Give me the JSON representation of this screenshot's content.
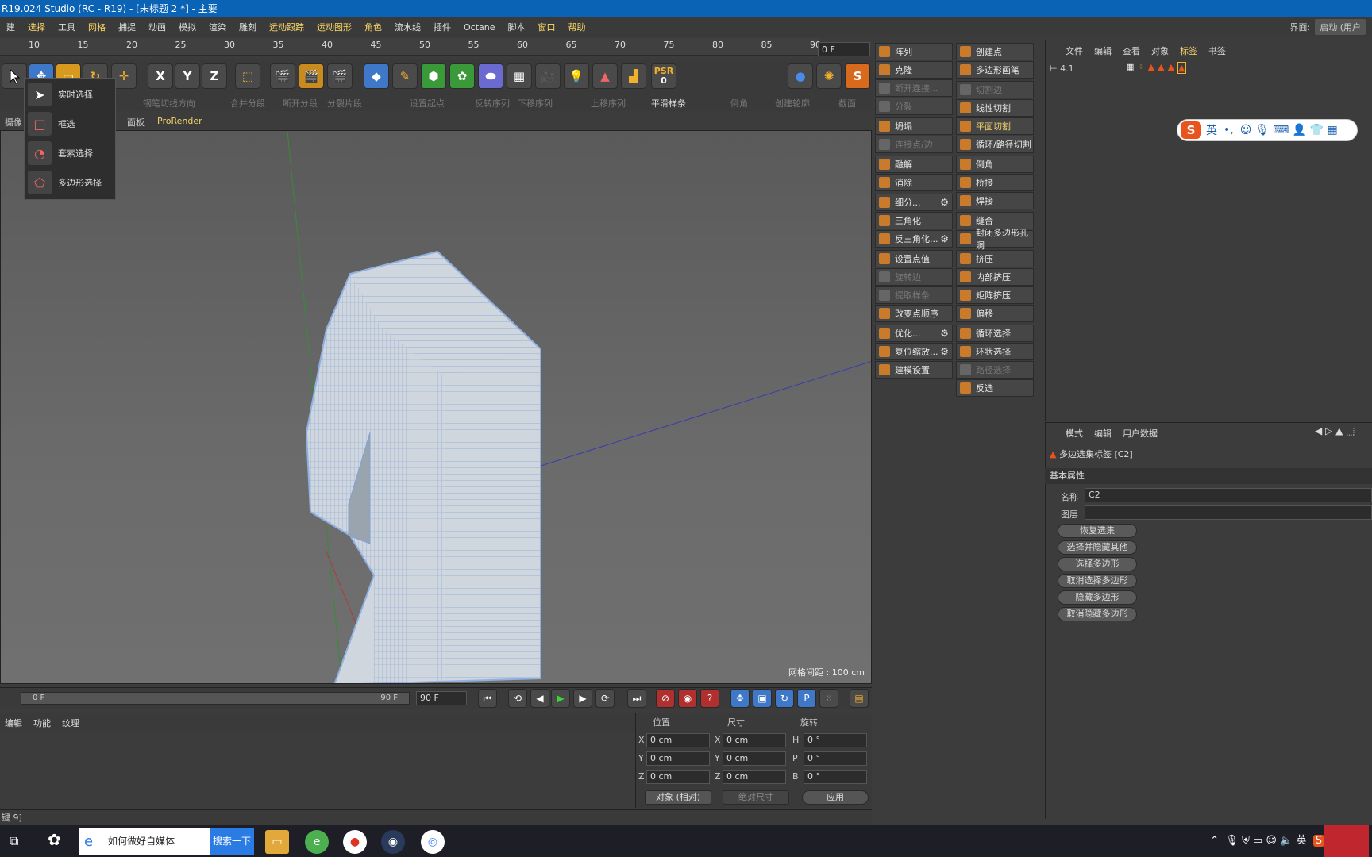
{
  "window": {
    "title": "R19.024 Studio (RC - R19) - [未标题 2 *] - 主要",
    "layout_label": "界面:",
    "layout_value": "启动 (用户"
  },
  "menu": [
    "建",
    "选择",
    "工具",
    "网格",
    "捕捉",
    "动画",
    "模拟",
    "渲染",
    "雕刻",
    "运动跟踪",
    "运动图形",
    "角色",
    "流水线",
    "插件",
    "Octane",
    "脚本",
    "窗口",
    "帮助"
  ],
  "ruler": {
    "ticks": [
      "10",
      "15",
      "20",
      "25",
      "30",
      "35",
      "40",
      "45",
      "50",
      "55",
      "60",
      "65",
      "70",
      "75",
      "80",
      "85",
      "90"
    ],
    "frame": "0 F"
  },
  "toolbar": {
    "x": "X",
    "y": "Y",
    "z": "Z",
    "psr": "PSR",
    "psr_value": "0"
  },
  "toolbar2": {
    "items": [
      "钢笔切线方向",
      "合并分段",
      "断开分段",
      "分裂片段",
      "设置起点",
      "反转序列",
      "下移序列",
      "上移序列",
      "平滑样条",
      "倒角",
      "创建轮廓",
      "截面"
    ]
  },
  "viewport_menu": {
    "items": [
      "摄像",
      "面板",
      "ProRender"
    ]
  },
  "select_popup": {
    "items": [
      "实时选择",
      "框选",
      "套索选择",
      "多边形选择"
    ]
  },
  "commands_left": [
    {
      "label": "阵列",
      "disabled": false
    },
    {
      "label": "克隆",
      "disabled": false
    },
    {
      "label": "断开连接...",
      "disabled": true
    },
    {
      "label": "分裂",
      "disabled": true
    },
    {
      "label": "坍塌",
      "disabled": false
    },
    {
      "label": "连接点/边",
      "disabled": true
    },
    {
      "label": "融解",
      "disabled": false
    },
    {
      "label": "消除",
      "disabled": false
    },
    {
      "label": "细分...",
      "disabled": false,
      "gear": true
    },
    {
      "label": "三角化",
      "disabled": false
    },
    {
      "label": "反三角化...",
      "disabled": false,
      "gear": true
    },
    {
      "label": "设置点值",
      "disabled": false
    },
    {
      "label": "旋转边",
      "disabled": true
    },
    {
      "label": "提取样条",
      "disabled": true
    },
    {
      "label": "改变点顺序",
      "disabled": false
    },
    {
      "label": "优化...",
      "disabled": false,
      "gear": true
    },
    {
      "label": "复位缩放...",
      "disabled": false,
      "gear": true
    },
    {
      "label": "建模设置",
      "disabled": false
    }
  ],
  "commands_right": [
    {
      "label": "创建点",
      "disabled": false
    },
    {
      "label": "多边形画笔",
      "disabled": false
    },
    {
      "label": "切割边",
      "disabled": true
    },
    {
      "label": "线性切割",
      "disabled": false
    },
    {
      "label": "平面切割",
      "disabled": false,
      "highlight": true
    },
    {
      "label": "循环/路径切割",
      "disabled": false
    },
    {
      "label": "倒角",
      "disabled": false
    },
    {
      "label": "桥接",
      "disabled": false
    },
    {
      "label": "焊接",
      "disabled": false
    },
    {
      "label": "缝合",
      "disabled": false
    },
    {
      "label": "封闭多边形孔洞",
      "disabled": false
    },
    {
      "label": "挤压",
      "disabled": false
    },
    {
      "label": "内部挤压",
      "disabled": false
    },
    {
      "label": "矩阵挤压",
      "disabled": false
    },
    {
      "label": "偏移",
      "disabled": false
    },
    {
      "label": "循环选择",
      "disabled": false
    },
    {
      "label": "环状选择",
      "disabled": false
    },
    {
      "label": "路径选择",
      "disabled": true
    },
    {
      "label": "反选",
      "disabled": false
    }
  ],
  "object_manager": {
    "menu": [
      "文件",
      "编辑",
      "查看",
      "对象",
      "标签",
      "书签"
    ],
    "active": "标签",
    "row_label": "4.1"
  },
  "ime": {
    "lang": "英",
    "symbols": "•,"
  },
  "attributes": {
    "menu": [
      "模式",
      "编辑",
      "用户数据"
    ],
    "tag_title": "多边选集标签 [C2]",
    "section": "基本属性",
    "name_label": "名称",
    "name_value": "C2",
    "layer_label": "图层",
    "layer_value": "",
    "buttons": [
      "恢复选集",
      "选择并隐藏其他",
      "选择多边形",
      "取消选择多边形",
      "隐藏多边形",
      "取消隐藏多边形"
    ]
  },
  "grid_spacing": "网格间距 : 100 cm",
  "timeline": {
    "start": "0 F",
    "end_label": "90 F",
    "end_field": "90 F"
  },
  "material_menu": [
    "编辑",
    "功能",
    "纹理"
  ],
  "coordinates": {
    "headers": [
      "位置",
      "尺寸",
      "旋转"
    ],
    "rows": [
      {
        "axis": "X",
        "pos": "0 cm",
        "size_axis": "X",
        "size": "0 cm",
        "rot_axis": "H",
        "rot": "0 °"
      },
      {
        "axis": "Y",
        "pos": "0 cm",
        "size_axis": "Y",
        "size": "0 cm",
        "rot_axis": "P",
        "rot": "0 °"
      },
      {
        "axis": "Z",
        "pos": "0 cm",
        "size_axis": "Z",
        "size": "0 cm",
        "rot_axis": "B",
        "rot": "0 °"
      }
    ],
    "mode": "对象 (相对)",
    "size_mode": "绝对尺寸",
    "apply": "应用"
  },
  "status": "键 9]",
  "taskbar": {
    "search_text": "如何做好自媒体",
    "search_button": "搜索一下",
    "ime": "英"
  }
}
